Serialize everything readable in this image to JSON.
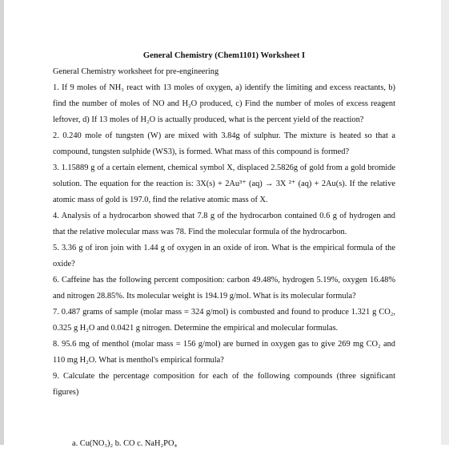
{
  "document": {
    "title": "General Chemistry (Chem1101) Worksheet I",
    "subtitle": "General Chemistry worksheet for pre-engineering",
    "questions": [
      {
        "number": "1.",
        "text": "If 9 moles of NH₃ react with 13 moles of oxygen, a) identify the limiting and excess reactants, b) find the number of moles of NO and H₂O produced, c) Find the number of moles of excess reagent leftover, d) If 13 moles of H₂O is actually produced, what is the percent yield of the reaction?"
      },
      {
        "number": "2.",
        "text": "0.240 mole of tungsten (W) are mixed with 3.84g of sulphur. The mixture is heated so that a compound, tungsten sulphide (WS3), is formed. What mass of this compound is formed?"
      },
      {
        "number": "3.",
        "text": "1.15889 g of a certain element, chemical symbol X, displaced 2.5826g of gold from a gold bromide solution. The equation for the reaction is: 3X(s) + 2Au³⁺ (aq) → 3X ²⁺ (aq) + 2Au(s). If the relative atomic mass of gold is 197.0, find the relative atomic mass of X."
      },
      {
        "number": "4.",
        "text": "Analysis of a hydrocarbon showed that 7.8 g of the hydrocarbon contained 0.6 g of hydrogen and that the relative molecular mass was 78. Find the molecular formula of the hydrocarbon."
      },
      {
        "number": "5.",
        "text": "3.36 g of iron join with 1.44 g of oxygen in an oxide of iron. What is the empirical formula of the oxide?"
      },
      {
        "number": "6.",
        "text": "Caffeine has the following percent composition: carbon 49.48%, hydrogen 5.19%, oxygen 16.48% and nitrogen 28.85%. Its molecular weight is 194.19 g/mol. What is its molecular formula?"
      },
      {
        "number": "7.",
        "text": "0.487 grams of sample (molar mass = 324 g/mol) is combusted and found to produce 1.321 g CO₂, 0.325 g H₂O and 0.0421 g nitrogen. Determine the empirical and molecular formulas."
      },
      {
        "number": "8.",
        "text": "95.6 mg of menthol (molar mass = 156 g/mol) are burned in oxygen gas to give 269 mg CO₂ and 110 mg H₂O. What is menthol's empirical formula?"
      },
      {
        "number": "9.",
        "text": "Calculate the percentage composition for each of the following compounds (three significant figures)"
      }
    ],
    "cut_off_line": "a. Cu(NO₃)₂            b. CO            c. NaH₂PO₄"
  }
}
